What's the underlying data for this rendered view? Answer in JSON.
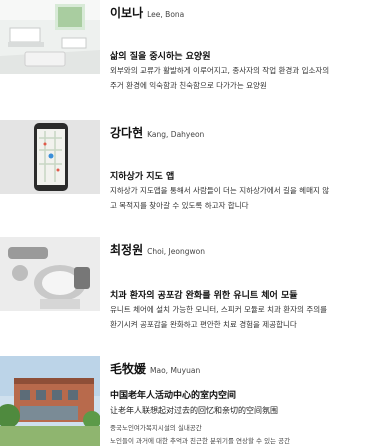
{
  "entries": [
    {
      "name_native": "이보나",
      "name_latin": "Lee, Bona",
      "title": "삶의 질을 중시하는 요양원",
      "desc": [
        "외부와의 교류가 활발하게 이루어지고, 종사자의 작업 환경과 입소자의",
        "주거 환경에 익숙함과 친숙함으로 다가가는 요양원"
      ],
      "thumb_icon": "interior-room-photo"
    },
    {
      "name_native": "강다현",
      "name_latin": "Kang, Dahyeon",
      "title": "지하상가 지도 앱",
      "desc": [
        "지하상가 지도앱을 통해서 사람들이 더는 지하상가에서 길을 헤매지 않",
        "고 목적지를 찾아갈 수 있도록 하고자 합니다"
      ],
      "thumb_icon": "smartphone-map-photo"
    },
    {
      "name_native": "최정원",
      "name_latin": "Choi, Jeongwon",
      "title": "치과 환자의 공포감 완화를 위한 유니트 체어 모듈",
      "desc": [
        "유니트 체어에 설치 가능한 모니터, 스피커 모듈로 치과 환자의 주의를",
        "환기시켜 공포감을 완화하고 편안한 치료 경험을 제공합니다"
      ],
      "thumb_icon": "dental-chair-render"
    },
    {
      "name_native": "毛牧媛",
      "name_latin": "Mao, Muyuan",
      "title": "中国老年人活动中心的室内空间",
      "subtitle": "让老年人联想起对过去的回忆和亲切的空间氛围",
      "desc": [
        "중국노인여가복지시설의 실내공간",
        "노인들이 과거에 대한 추억과 친근한 분위기를 연상할 수 있는 공간"
      ],
      "thumb_icon": "building-exterior-render"
    }
  ]
}
